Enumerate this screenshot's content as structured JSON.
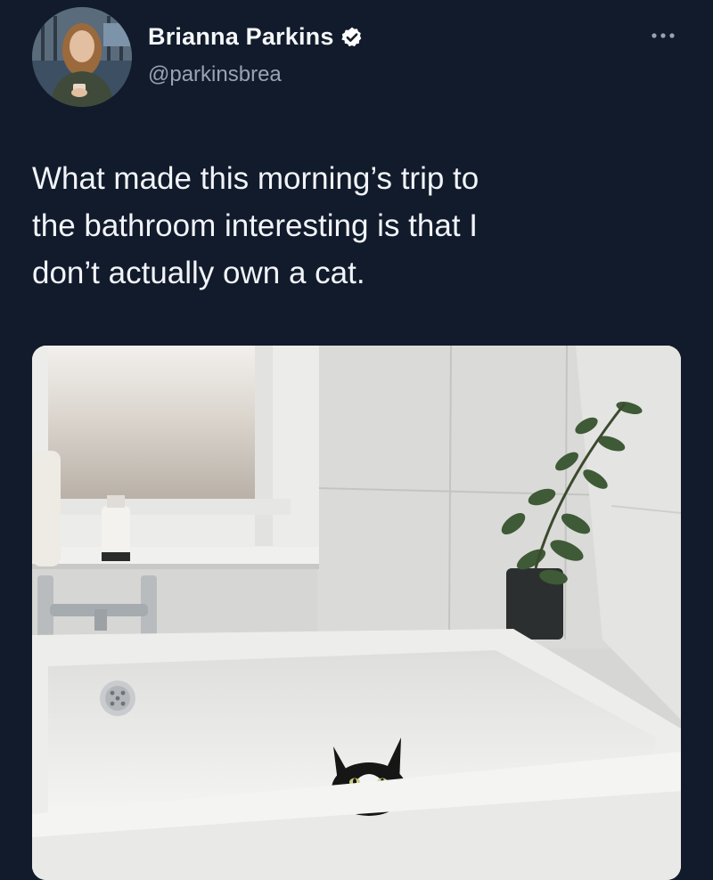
{
  "author": {
    "display_name": "Brianna Parkins",
    "handle": "@parkinsbrea",
    "verified": true,
    "avatar_icon": "profile-photo",
    "verified_icon": "verified-badge-icon"
  },
  "tweet": {
    "text": "What made this morning’s trip to\nthe bathroom interesting is that I\ndon’t actually own a cat.",
    "media": {
      "type": "photo",
      "subject": "cat peeking over the edge of a white bathtub"
    }
  },
  "menu_icon": "more-options-icon",
  "colors": {
    "background": "#121b2b",
    "text": "#f1f4f8",
    "secondary_text": "#97a3b4",
    "verified_badge": "#ffffff"
  }
}
